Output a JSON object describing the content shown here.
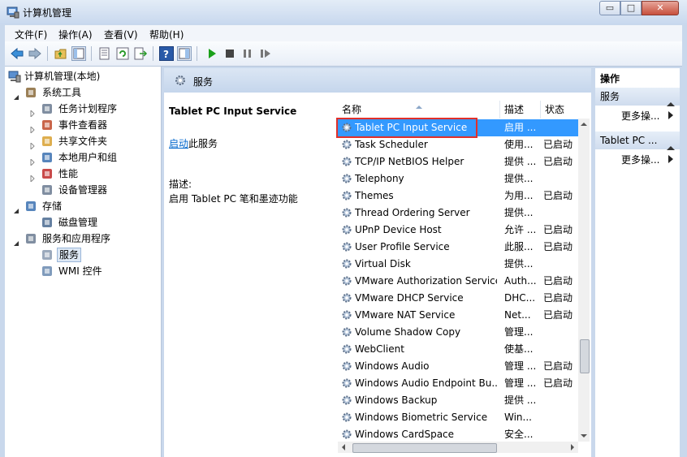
{
  "window": {
    "title": "计算机管理",
    "minimize": "▭",
    "maximize": "□",
    "close": "✕"
  },
  "menu": [
    "文件(F)",
    "操作(A)",
    "查看(V)",
    "帮助(H)"
  ],
  "tree": {
    "root": "计算机管理(本地)",
    "items": [
      {
        "label": "系统工具",
        "level": 1,
        "expanded": true
      },
      {
        "label": "任务计划程序",
        "level": 2,
        "expanded": false
      },
      {
        "label": "事件查看器",
        "level": 2,
        "expanded": false
      },
      {
        "label": "共享文件夹",
        "level": 2,
        "expanded": false
      },
      {
        "label": "本地用户和组",
        "level": 2,
        "expanded": false
      },
      {
        "label": "性能",
        "level": 2,
        "expanded": false
      },
      {
        "label": "设备管理器",
        "level": 2
      },
      {
        "label": "存储",
        "level": 1,
        "expanded": true
      },
      {
        "label": "磁盘管理",
        "level": 2
      },
      {
        "label": "服务和应用程序",
        "level": 1,
        "expanded": true
      },
      {
        "label": "服务",
        "level": 2,
        "selected": true
      },
      {
        "label": "WMI 控件",
        "level": 2
      }
    ]
  },
  "center": {
    "header": "服务",
    "detail": {
      "service_name": "Tablet PC Input Service",
      "start_link": "启动",
      "start_suffix": "此服务",
      "desc_label": "描述:",
      "desc_text": "启用 Tablet PC 笔和墨迹功能"
    },
    "columns": {
      "name": "名称",
      "desc": "描述",
      "status": "状态"
    },
    "services": [
      {
        "name": "Tablet PC Input Service",
        "desc": "启用 ...",
        "status": "",
        "selected": true
      },
      {
        "name": "Task Scheduler",
        "desc": "使用...",
        "status": "已启动"
      },
      {
        "name": "TCP/IP NetBIOS Helper",
        "desc": "提供 ...",
        "status": "已启动"
      },
      {
        "name": "Telephony",
        "desc": "提供...",
        "status": ""
      },
      {
        "name": "Themes",
        "desc": "为用...",
        "status": "已启动"
      },
      {
        "name": "Thread Ordering Server",
        "desc": "提供...",
        "status": ""
      },
      {
        "name": "UPnP Device Host",
        "desc": "允许 ...",
        "status": "已启动"
      },
      {
        "name": "User Profile Service",
        "desc": "此服...",
        "status": "已启动"
      },
      {
        "name": "Virtual Disk",
        "desc": "提供...",
        "status": ""
      },
      {
        "name": "VMware Authorization Service",
        "desc": "Auth...",
        "status": "已启动"
      },
      {
        "name": "VMware DHCP Service",
        "desc": "DHC...",
        "status": "已启动"
      },
      {
        "name": "VMware NAT Service",
        "desc": "Net...",
        "status": "已启动"
      },
      {
        "name": "Volume Shadow Copy",
        "desc": "管理...",
        "status": ""
      },
      {
        "name": "WebClient",
        "desc": "使基...",
        "status": ""
      },
      {
        "name": "Windows Audio",
        "desc": "管理 ...",
        "status": "已启动"
      },
      {
        "name": "Windows Audio Endpoint Bu...",
        "desc": "管理 ...",
        "status": "已启动"
      },
      {
        "name": "Windows Backup",
        "desc": "提供 ...",
        "status": ""
      },
      {
        "name": "Windows Biometric Service",
        "desc": "Win...",
        "status": ""
      },
      {
        "name": "Windows CardSpace",
        "desc": "安全...",
        "status": ""
      }
    ]
  },
  "actions": {
    "title": "操作",
    "sections": [
      {
        "header": "服务",
        "more": "更多操..."
      },
      {
        "header": "Tablet PC ...",
        "more": "更多操..."
      }
    ]
  },
  "colors": {
    "selection": "#3399ff",
    "highlight_box": "#e0302a",
    "link": "#0066cc",
    "play": "#1aa01a"
  }
}
